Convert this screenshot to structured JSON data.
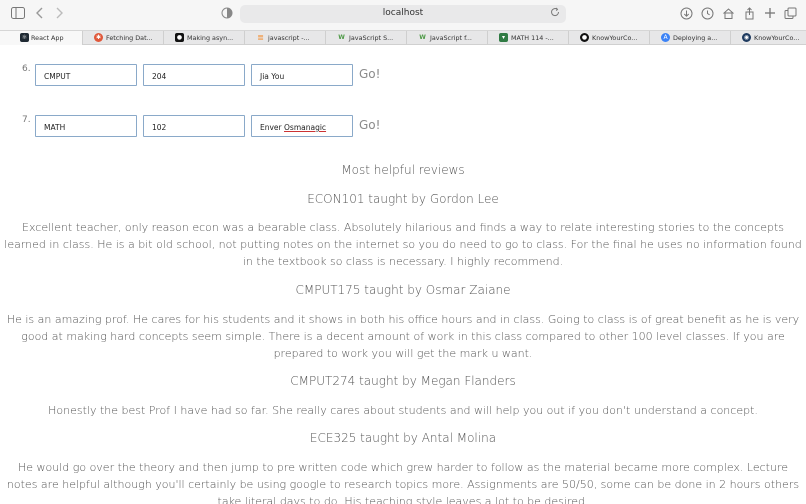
{
  "browser": {
    "url": "localhost",
    "tabs": [
      {
        "label": "React App",
        "icon": "react-icon",
        "color": "#1f2a33"
      },
      {
        "label": "Fetching Dat...",
        "icon": "fetch-icon",
        "color": "#e0583a"
      },
      {
        "label": "Making asyn...",
        "icon": "github-icon",
        "color": "#111111"
      },
      {
        "label": "javascript -...",
        "icon": "stack-icon",
        "color": "#f3953e"
      },
      {
        "label": "JavaScript S...",
        "icon": "w3-icon",
        "color": "#4e9a46"
      },
      {
        "label": "JavaScript f...",
        "icon": "w3-icon",
        "color": "#4e9a46"
      },
      {
        "label": "MATH 114 -...",
        "icon": "shield-icon",
        "color": "#2f7a43"
      },
      {
        "label": "KnowYourCo...",
        "icon": "github-icon",
        "color": "#111111"
      },
      {
        "label": "Deploying a...",
        "icon": "deploy-icon",
        "color": "#3b82f6"
      },
      {
        "label": "KnowYourCo...",
        "icon": "site-icon",
        "color": "#1e3a5f"
      }
    ]
  },
  "form_rows": [
    {
      "num": "6.",
      "subject": "CMPUT",
      "number": "204",
      "prof_first": "Jia You",
      "prof_last": "",
      "go": "Go!"
    },
    {
      "num": "7.",
      "subject": "MATH",
      "number": "102",
      "prof_first": "Enver ",
      "prof_last": "Osmanagic",
      "go": "Go!"
    }
  ],
  "section_title": "Most helpful reviews",
  "reviews": [
    {
      "heading": "ECON101 taught by Gordon Lee",
      "body": "Excellent teacher, only reason econ was a bearable class. Absolutely hilarious and finds a way to relate interesting stories to the concepts learned in class. He is a bit old school, not putting notes on the internet so you do need to go to class. For the final he uses no information found in the textbook so class is necessary. I highly recommend."
    },
    {
      "heading": "CMPUT175 taught by Osmar Zaiane",
      "body": "He is an amazing prof. He cares for his students and it shows in both his office hours and in class. Going to class is of great benefit as he is very good at making hard concepts seem simple. There is a decent amount of work in this class compared to other 100 level classes. If you are prepared to work you will get the mark u want."
    },
    {
      "heading": "CMPUT274 taught by Megan Flanders",
      "body": "Honestly the best Prof I have had so far. She really cares about students and will help you out if you don't understand a concept."
    },
    {
      "heading": "ECE325 taught by Antal Molina",
      "body": "He would go over the theory and then jump to pre written code which grew harder to follow as the material became more complex. Lecture notes are helpful although you'll certainly be using google to research topics more. Assignments are 50/50, some can be done in 2 hours others take literal days to do. His teaching style leaves a lot to be desired."
    }
  ]
}
